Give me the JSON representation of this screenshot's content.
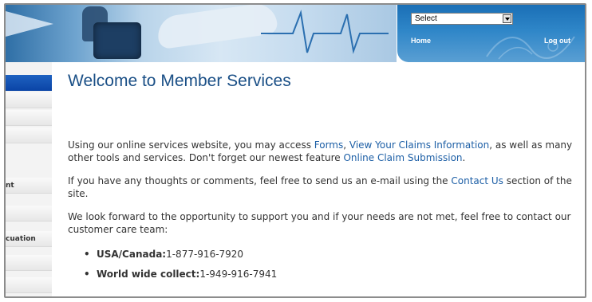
{
  "header": {
    "select": {
      "value": "Select"
    },
    "nav": {
      "home": "Home",
      "logout": "Log out"
    }
  },
  "sidebar": {
    "items": [
      {
        "label": ""
      },
      {
        "label": ""
      },
      {
        "label": ""
      },
      {
        "label": "nt"
      },
      {
        "label": ""
      },
      {
        "label": "cuation"
      },
      {
        "label": ""
      },
      {
        "label": ""
      }
    ]
  },
  "main": {
    "title": "Welcome to Member Services",
    "p1": {
      "t1": "Using our online services website, you may access ",
      "link_forms": "Forms",
      "t2": ", ",
      "link_claims": "View Your Claims Information",
      "t3": ", as well as many other tools and services. Don't forget our newest feature ",
      "link_online": "Online Claim Submission",
      "t4": "."
    },
    "p2": {
      "t1": "If you have any thoughts or comments, feel free to send us an e-mail using the ",
      "link_contact": "Contact Us",
      "t2": " section of the site."
    },
    "p3": "We look forward to the opportunity to support you and if your needs are not met, feel free to contact our customer care team:",
    "contacts": [
      {
        "label": "USA/Canada:",
        "value": "1-877-916-7920"
      },
      {
        "label": "World wide collect:",
        "value": "1-949-916-7941"
      }
    ]
  },
  "colors": {
    "title": "#1a4f86",
    "link": "#1d5fa6",
    "sidebar_head": "#0a44a6",
    "banner_panel": "#2f86c8"
  }
}
